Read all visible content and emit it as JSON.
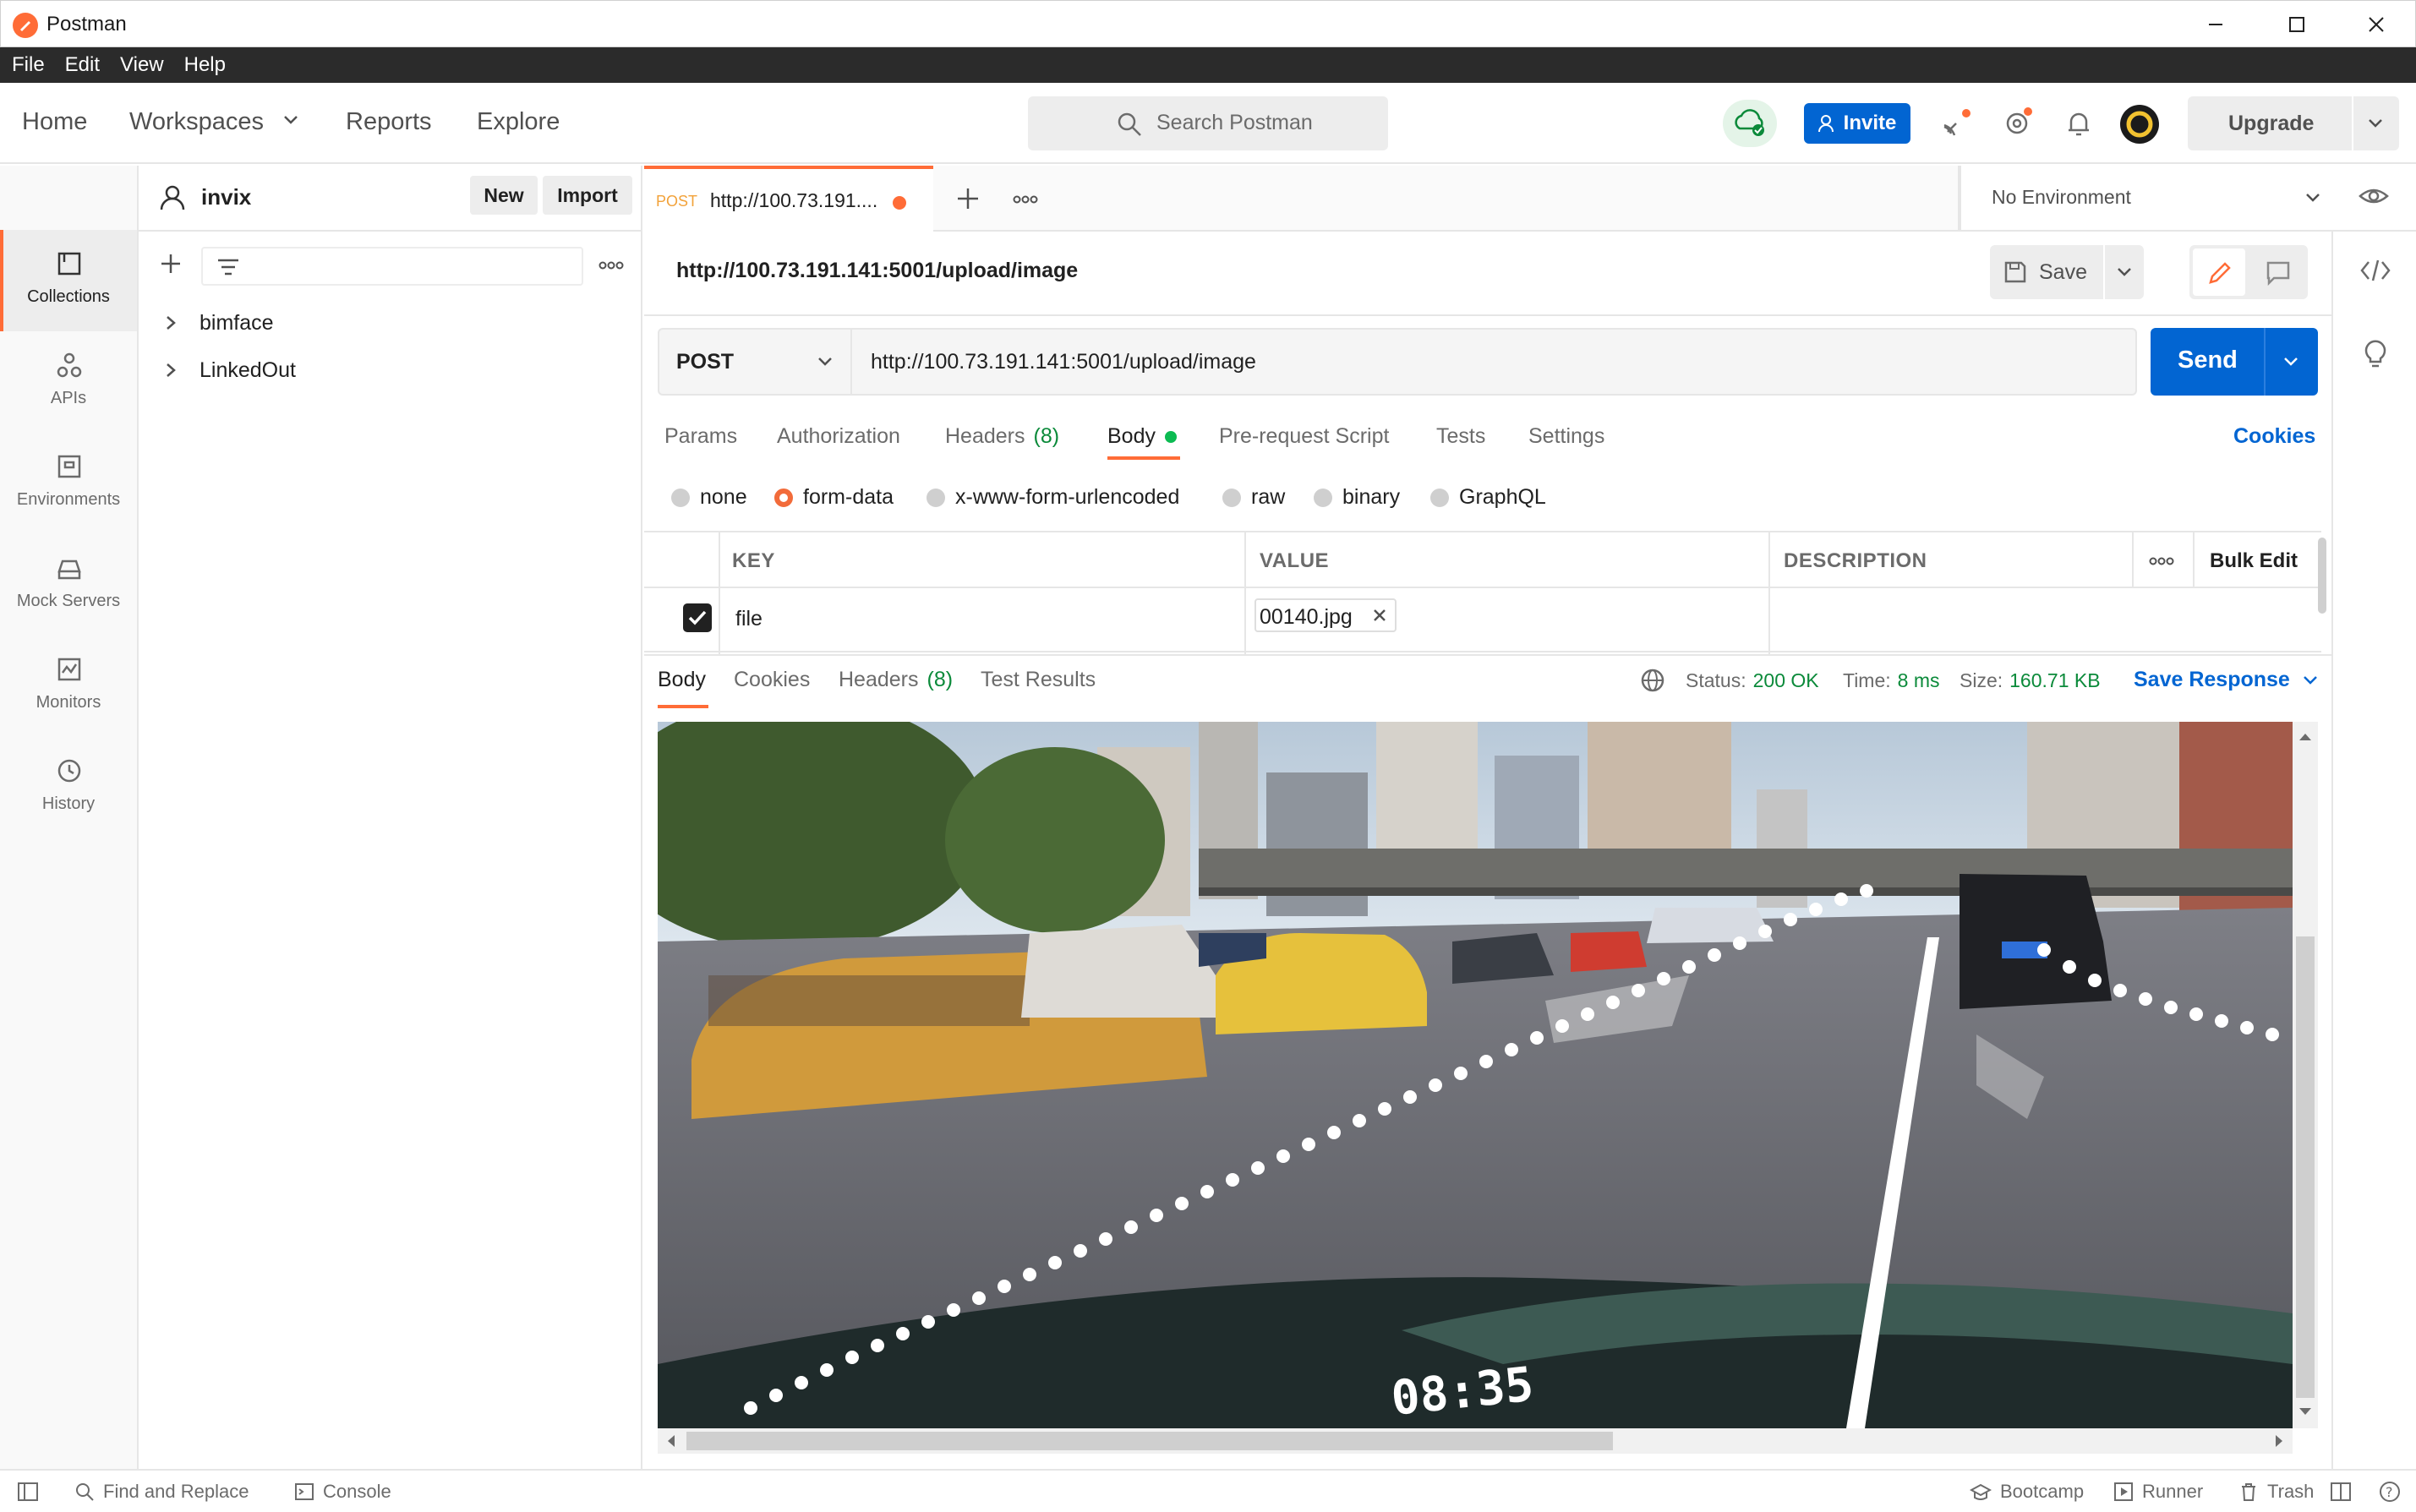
{
  "window": {
    "title": "Postman"
  },
  "menu": [
    "File",
    "Edit",
    "View",
    "Help"
  ],
  "header": {
    "nav": [
      "Home",
      "Workspaces",
      "Reports",
      "Explore"
    ],
    "search_placeholder": "Search Postman",
    "invite_label": "Invite",
    "upgrade_label": "Upgrade"
  },
  "sidebar": {
    "items": [
      {
        "label": "Collections",
        "icon": "collections-icon"
      },
      {
        "label": "APIs",
        "icon": "apis-icon"
      },
      {
        "label": "Environments",
        "icon": "environments-icon"
      },
      {
        "label": "Mock Servers",
        "icon": "mock-servers-icon"
      },
      {
        "label": "Monitors",
        "icon": "monitors-icon"
      },
      {
        "label": "History",
        "icon": "history-icon"
      }
    ]
  },
  "collections": {
    "user": "invix",
    "new_label": "New",
    "import_label": "Import",
    "items": [
      "bimface",
      "LinkedOut"
    ]
  },
  "tab": {
    "method": "POST",
    "title": "http://100.73.191...."
  },
  "env": {
    "selected": "No Environment"
  },
  "request": {
    "name": "http://100.73.191.141:5001/upload/image",
    "save_label": "Save",
    "method": "POST",
    "url": "http://100.73.191.141:5001/upload/image",
    "send_label": "Send"
  },
  "req_tabs": {
    "params": "Params",
    "authorization": "Authorization",
    "headers": "Headers",
    "headers_count": "(8)",
    "body": "Body",
    "prerequest": "Pre-request Script",
    "tests": "Tests",
    "settings": "Settings",
    "cookies": "Cookies"
  },
  "body_types": [
    "none",
    "form-data",
    "x-www-form-urlencoded",
    "raw",
    "binary",
    "GraphQL"
  ],
  "table": {
    "headers": {
      "key": "KEY",
      "value": "VALUE",
      "description": "DESCRIPTION",
      "bulk_edit": "Bulk Edit"
    },
    "rows": [
      {
        "key": "file",
        "value": "00140.jpg",
        "description": ""
      }
    ]
  },
  "response": {
    "tabs": {
      "body": "Body",
      "cookies": "Cookies",
      "headers": "Headers",
      "headers_count": "(8)",
      "test_results": "Test Results"
    },
    "status_label": "Status:",
    "status_value": "200 OK",
    "time_label": "Time:",
    "time_value": "8 ms",
    "size_label": "Size:",
    "size_value": "160.71 KB",
    "save_response": "Save Response",
    "image_timestamp": "08:35"
  },
  "statusbar": {
    "find_replace": "Find and Replace",
    "console": "Console",
    "bootcamp": "Bootcamp",
    "runner": "Runner",
    "trash": "Trash"
  },
  "colors": {
    "accent": "#ff6c37",
    "primary_blue": "#0265d2",
    "success_green": "#0b8a3a"
  }
}
